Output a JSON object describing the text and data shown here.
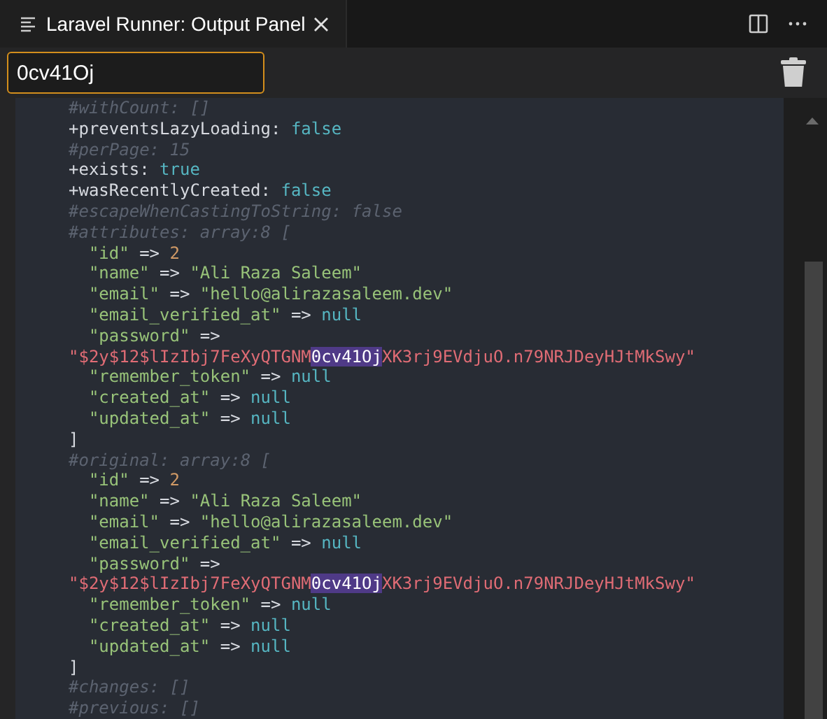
{
  "tab": {
    "title": "Laravel Runner: Output Panel",
    "selected": true
  },
  "filter": {
    "value": "0cv41Oj"
  },
  "output": [
    {
      "segments": [
        {
          "kind": "comment",
          "text": "#withCount: []"
        }
      ]
    },
    {
      "segments": [
        {
          "kind": "prop",
          "text": "+preventsLazyLoading: "
        },
        {
          "kind": "keyword",
          "text": "false"
        }
      ]
    },
    {
      "segments": [
        {
          "kind": "comment",
          "text": "#perPage: 15"
        }
      ]
    },
    {
      "segments": [
        {
          "kind": "prop",
          "text": "+exists: "
        },
        {
          "kind": "keyword",
          "text": "true"
        }
      ]
    },
    {
      "segments": [
        {
          "kind": "prop",
          "text": "+wasRecentlyCreated: "
        },
        {
          "kind": "keyword",
          "text": "false"
        }
      ]
    },
    {
      "segments": [
        {
          "kind": "comment",
          "text": "#escapeWhenCastingToString: false"
        }
      ]
    },
    {
      "segments": [
        {
          "kind": "comment",
          "text": "#attributes: array:8 ["
        }
      ],
      "close": "]",
      "children": [
        {
          "segments": [
            {
              "kind": "string",
              "text": "\"id\""
            },
            {
              "kind": "prop",
              "text": " => "
            },
            {
              "kind": "number",
              "text": "2"
            }
          ]
        },
        {
          "segments": [
            {
              "kind": "string",
              "text": "\"name\""
            },
            {
              "kind": "prop",
              "text": " => "
            },
            {
              "kind": "string",
              "text": "\"Ali Raza Saleem\""
            }
          ]
        },
        {
          "segments": [
            {
              "kind": "string",
              "text": "\"email\""
            },
            {
              "kind": "prop",
              "text": " => "
            },
            {
              "kind": "string",
              "text": "\"hello@alirazasaleem.dev\""
            }
          ]
        },
        {
          "segments": [
            {
              "kind": "string",
              "text": "\"email_verified_at\""
            },
            {
              "kind": "prop",
              "text": " => "
            },
            {
              "kind": "keyword",
              "text": "null"
            }
          ]
        },
        {
          "segments": [
            {
              "kind": "string",
              "text": "\"password\""
            },
            {
              "kind": "prop",
              "text": " =>"
            }
          ],
          "continuation": [
            {
              "kind": "secret",
              "text": "\"$2y$12$lIzIbj7FeXyQTGNM"
            },
            {
              "kind": "match",
              "text": "0cv41Oj"
            },
            {
              "kind": "secret",
              "text": "XK3rj9EVdjuO.n79NRJDeyHJtMkSwy\""
            }
          ]
        },
        {
          "segments": [
            {
              "kind": "string",
              "text": "\"remember_token\""
            },
            {
              "kind": "prop",
              "text": " => "
            },
            {
              "kind": "keyword",
              "text": "null"
            }
          ]
        },
        {
          "segments": [
            {
              "kind": "string",
              "text": "\"created_at\""
            },
            {
              "kind": "prop",
              "text": " => "
            },
            {
              "kind": "keyword",
              "text": "null"
            }
          ]
        },
        {
          "segments": [
            {
              "kind": "string",
              "text": "\"updated_at\""
            },
            {
              "kind": "prop",
              "text": " => "
            },
            {
              "kind": "keyword",
              "text": "null"
            }
          ]
        }
      ]
    },
    {
      "segments": [
        {
          "kind": "comment",
          "text": "#original: array:8 ["
        }
      ],
      "close": "]",
      "children": [
        {
          "segments": [
            {
              "kind": "string",
              "text": "\"id\""
            },
            {
              "kind": "prop",
              "text": " => "
            },
            {
              "kind": "number",
              "text": "2"
            }
          ]
        },
        {
          "segments": [
            {
              "kind": "string",
              "text": "\"name\""
            },
            {
              "kind": "prop",
              "text": " => "
            },
            {
              "kind": "string",
              "text": "\"Ali Raza Saleem\""
            }
          ]
        },
        {
          "segments": [
            {
              "kind": "string",
              "text": "\"email\""
            },
            {
              "kind": "prop",
              "text": " => "
            },
            {
              "kind": "string",
              "text": "\"hello@alirazasaleem.dev\""
            }
          ]
        },
        {
          "segments": [
            {
              "kind": "string",
              "text": "\"email_verified_at\""
            },
            {
              "kind": "prop",
              "text": " => "
            },
            {
              "kind": "keyword",
              "text": "null"
            }
          ]
        },
        {
          "segments": [
            {
              "kind": "string",
              "text": "\"password\""
            },
            {
              "kind": "prop",
              "text": " =>"
            }
          ],
          "continuation": [
            {
              "kind": "secret",
              "text": "\"$2y$12$lIzIbj7FeXyQTGNM"
            },
            {
              "kind": "match",
              "text": "0cv41Oj"
            },
            {
              "kind": "secret",
              "text": "XK3rj9EVdjuO.n79NRJDeyHJtMkSwy\""
            }
          ]
        },
        {
          "segments": [
            {
              "kind": "string",
              "text": "\"remember_token\""
            },
            {
              "kind": "prop",
              "text": " => "
            },
            {
              "kind": "keyword",
              "text": "null"
            }
          ]
        },
        {
          "segments": [
            {
              "kind": "string",
              "text": "\"created_at\""
            },
            {
              "kind": "prop",
              "text": " => "
            },
            {
              "kind": "keyword",
              "text": "null"
            }
          ]
        },
        {
          "segments": [
            {
              "kind": "string",
              "text": "\"updated_at\""
            },
            {
              "kind": "prop",
              "text": " => "
            },
            {
              "kind": "keyword",
              "text": "null"
            }
          ]
        }
      ]
    },
    {
      "segments": [
        {
          "kind": "comment",
          "text": "#changes: []"
        }
      ]
    },
    {
      "segments": [
        {
          "kind": "comment",
          "text": "#previous: []"
        }
      ]
    }
  ]
}
